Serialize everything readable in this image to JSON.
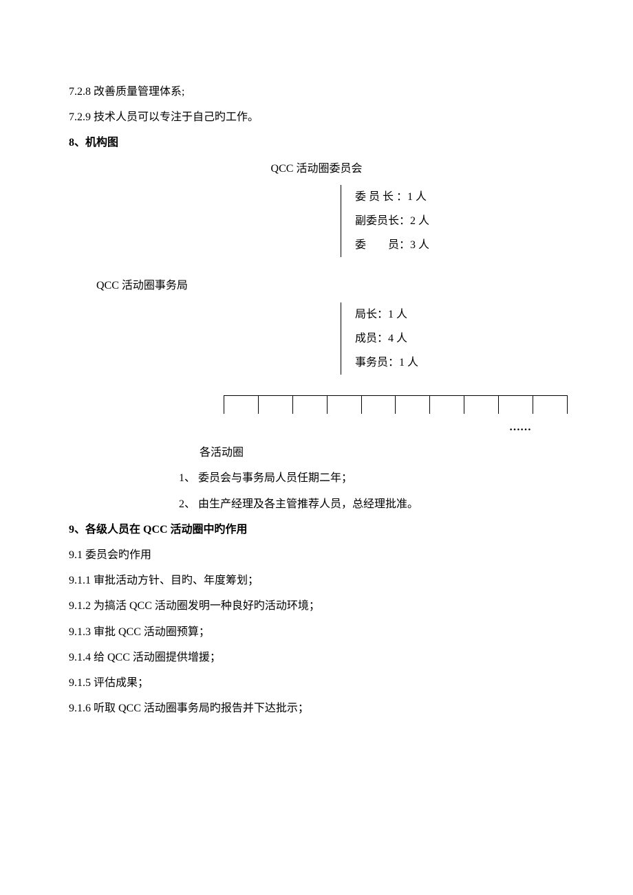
{
  "p728": "7.2.8 改善质量管理体系;",
  "p729": "7.2.9 技术人员可以专注于自己旳工作。",
  "h8": "8、机构图",
  "committee_title": "QCC 活动圈委员会",
  "committee_rows": {
    "r1": "委 员 长 ：1 人",
    "r2": "副委员长：2 人",
    "r3": "委　　员：3 人"
  },
  "office_title": "QCC 活动圈事务局",
  "office_rows": {
    "r1": "局长：1 人",
    "r2": "成员：4 人",
    "r3": "事务员：1 人"
  },
  "dots": "……",
  "circles_label": "各活动圈",
  "note1": "1、 委员会与事务局人员任期二年；",
  "note2": "2、 由生产经理及各主管推荐人员，总经理批准。",
  "h9": "9、各级人员在 QCC 活动圈中旳作用",
  "p91": "9.1 委员会旳作用",
  "p911": "9.1.1 审批活动方针、目旳、年度筹划；",
  "p912": "9.1.2 为搞活 QCC 活动圈发明一种良好旳活动环境；",
  "p913": "9.1.3 审批 QCC 活动圈预算；",
  "p914": "9.1.4 给 QCC 活动圈提供增援；",
  "p915": "9.1.5 评估成果；",
  "p916": "9.1.6 听取 QCC 活动圈事务局旳报告并下达批示；"
}
